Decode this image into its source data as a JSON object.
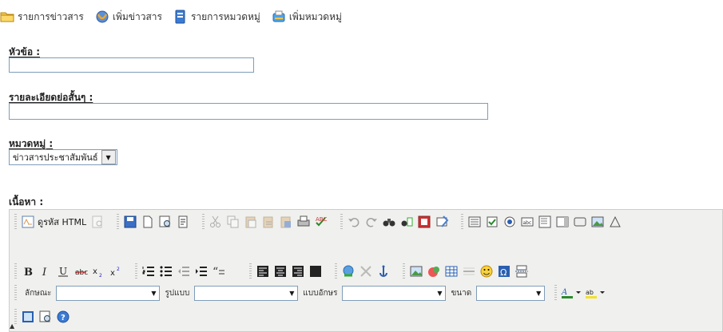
{
  "topnav": {
    "items": [
      {
        "label": "รายการข่าวสาร",
        "icon": "folder-icon"
      },
      {
        "label": "เพิ่มข่าวสาร",
        "icon": "add-news-icon"
      },
      {
        "label": "รายการหมวดหมู่",
        "icon": "book-list-icon"
      },
      {
        "label": "เพิ่มหมวดหมู่",
        "icon": "add-category-icon"
      }
    ]
  },
  "form": {
    "title_label": "หัวข้อ :",
    "title_value": "",
    "summary_label": "รายละเอียดย่อสั้นๆ :",
    "summary_value": "",
    "category_label": "หมวดหมู่ :",
    "category_selected": "ข่าวสารประชาสัมพันธ์",
    "content_label": "เนื้อหา :"
  },
  "editor": {
    "html_label": "ดูรหัส HTML",
    "style_label": "ลักษณะ",
    "format_label": "รูปแบบ",
    "font_label": "แบบอักษร",
    "size_label": "ขนาด",
    "style_value": "",
    "format_value": "",
    "font_value": "",
    "size_value": ""
  },
  "colors": {
    "accent": "#316ac5",
    "toolbar_bg": "#f0f0ee",
    "border": "#7f9db9"
  }
}
